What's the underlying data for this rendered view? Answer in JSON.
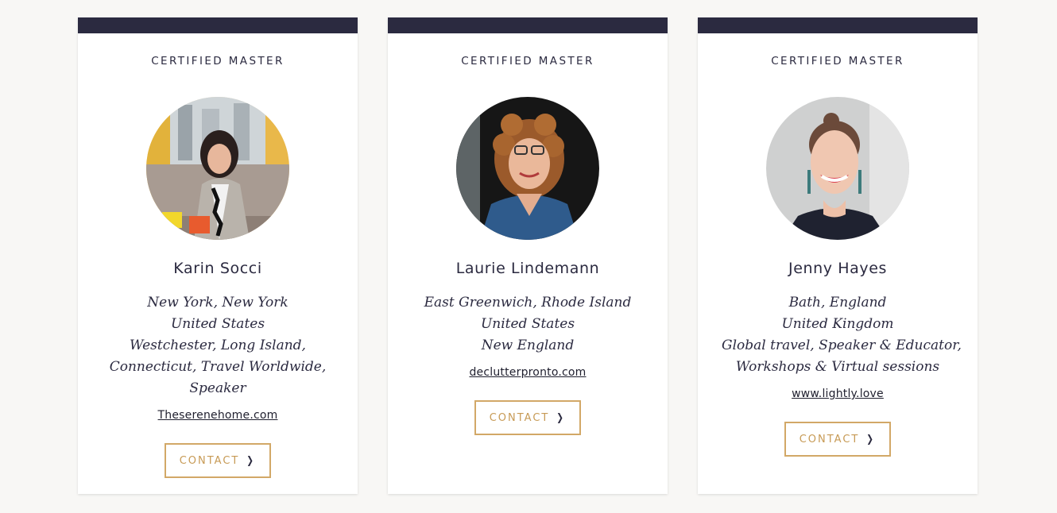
{
  "cards": [
    {
      "badge": "CERTIFIED MASTER",
      "name": "Karin Socci",
      "location_lines": [
        "New York, New York",
        "United States",
        "Westchester, Long Island,",
        "Connecticut, Travel Worldwide,",
        "Speaker"
      ],
      "website": "Theserenehome.com",
      "contact_label": "CONTACT",
      "chevron_icon": "chevron-right-icon"
    },
    {
      "badge": "CERTIFIED MASTER",
      "name": "Laurie Lindemann",
      "location_lines": [
        "East Greenwich, Rhode Island",
        "United States",
        "New England"
      ],
      "website": "declutterpronto.com",
      "contact_label": "CONTACT",
      "chevron_icon": "chevron-right-icon"
    },
    {
      "badge": "CERTIFIED MASTER",
      "name": "Jenny Hayes",
      "location_lines": [
        "Bath, England",
        "United Kingdom",
        "Global travel, Speaker & Educator,",
        "Workshops & Virtual sessions"
      ],
      "website": "www.lightly.love",
      "contact_label": "CONTACT",
      "chevron_icon": "chevron-right-icon"
    }
  ],
  "colors": {
    "card_bar": "#2b2a40",
    "accent": "#d2a867",
    "text": "#2b2a40",
    "background": "#f8f7f5"
  }
}
